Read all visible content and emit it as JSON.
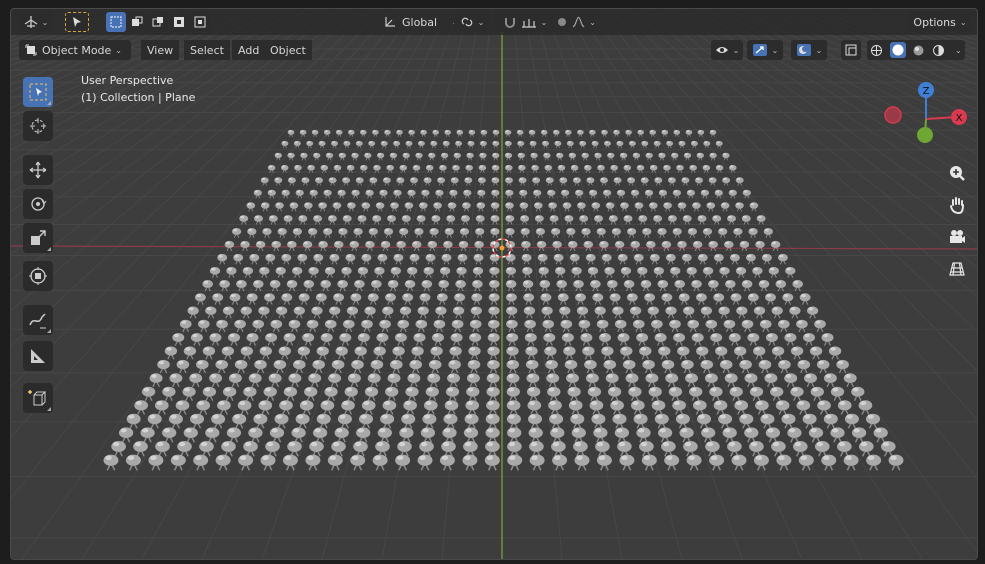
{
  "toolbar": {
    "transform_orientation": "Global",
    "options_label": "Options"
  },
  "header": {
    "mode_label": "Object Mode",
    "menus": [
      "View",
      "Select",
      "Add",
      "Object"
    ]
  },
  "viewport": {
    "view_name": "User Perspective",
    "collection_info": "(1) Collection | Plane",
    "axes": {
      "z": "Z",
      "x": "X"
    }
  },
  "colors": {
    "grid_background": "#3d3d3d",
    "x_axis_line": "#8a3c4a",
    "y_axis_line": "#7ca63a",
    "active_tool": "#4772b3",
    "gizmo_x": "#d93a50",
    "gizmo_y": "#6ea733",
    "gizmo_z": "#3f7fd8"
  },
  "icons": {
    "left_tools": [
      "select-box-icon",
      "cursor-icon",
      "move-icon",
      "rotate-icon",
      "scale-icon",
      "transform-icon",
      "annotate-icon",
      "measure-icon",
      "add-cube-icon"
    ],
    "nav": [
      "zoom-icon",
      "pan-hand-icon",
      "camera-icon",
      "perspective-grid-icon"
    ]
  }
}
